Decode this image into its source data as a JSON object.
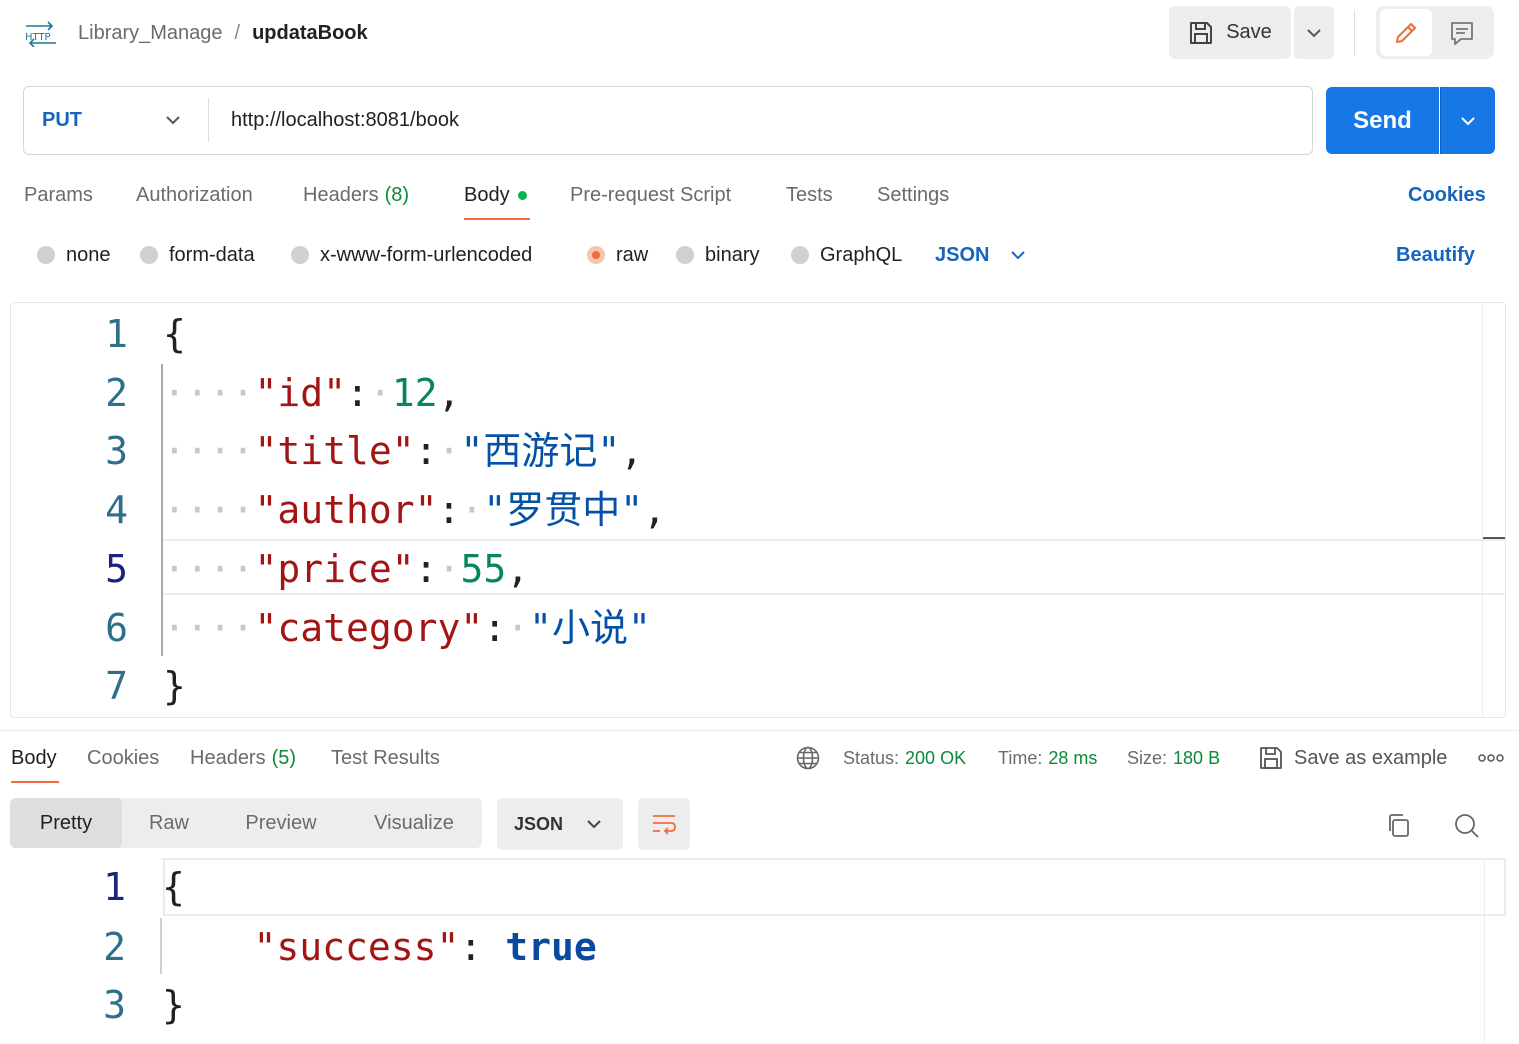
{
  "breadcrumb": {
    "icon_label": "HTTP",
    "collection": "Library_Manage",
    "separator": "/",
    "request": "updataBook"
  },
  "toolbar": {
    "save_label": "Save"
  },
  "request": {
    "method": "PUT",
    "url": "http://localhost:8081/book",
    "send_label": "Send",
    "tabs": [
      {
        "label": "Params"
      },
      {
        "label": "Authorization"
      },
      {
        "label": "Headers",
        "count": "(8)"
      },
      {
        "label": "Body"
      },
      {
        "label": "Pre-request Script"
      },
      {
        "label": "Tests"
      },
      {
        "label": "Settings"
      }
    ],
    "cookies_label": "Cookies",
    "body_types": [
      "none",
      "form-data",
      "x-www-form-urlencoded",
      "raw",
      "binary",
      "GraphQL"
    ],
    "selected_body_type": "raw",
    "language": "JSON",
    "beautify_label": "Beautify",
    "body_lines": {
      "l1": "{",
      "l2_key": "\"id\"",
      "l2_val": "12",
      "l3_key": "\"title\"",
      "l3_val": "\"西游记\"",
      "l4_key": "\"author\"",
      "l4_val": "\"罗贯中\"",
      "l5_key": "\"price\"",
      "l5_val": "55",
      "l6_key": "\"category\"",
      "l6_val": "\"小说\"",
      "l7": "}"
    },
    "line_numbers": [
      "1",
      "2",
      "3",
      "4",
      "5",
      "6",
      "7"
    ]
  },
  "response": {
    "tabs": [
      {
        "label": "Body"
      },
      {
        "label": "Cookies"
      },
      {
        "label": "Headers",
        "count": "(5)"
      },
      {
        "label": "Test Results"
      }
    ],
    "status_label": "Status:",
    "status_value": "200 OK",
    "time_label": "Time:",
    "time_value": "28 ms",
    "size_label": "Size:",
    "size_value": "180 B",
    "save_example_label": "Save as example",
    "view_modes": [
      "Pretty",
      "Raw",
      "Preview",
      "Visualize"
    ],
    "language": "JSON",
    "body_lines": {
      "l1": "{",
      "l2_key": "\"success\"",
      "l2_val": "true",
      "l3": "}"
    },
    "line_numbers": [
      "1",
      "2",
      "3"
    ]
  },
  "colors": {
    "accent": "#f26b3a",
    "primary": "#1677e5",
    "link": "#1565c0",
    "success": "#0a8a3a"
  }
}
